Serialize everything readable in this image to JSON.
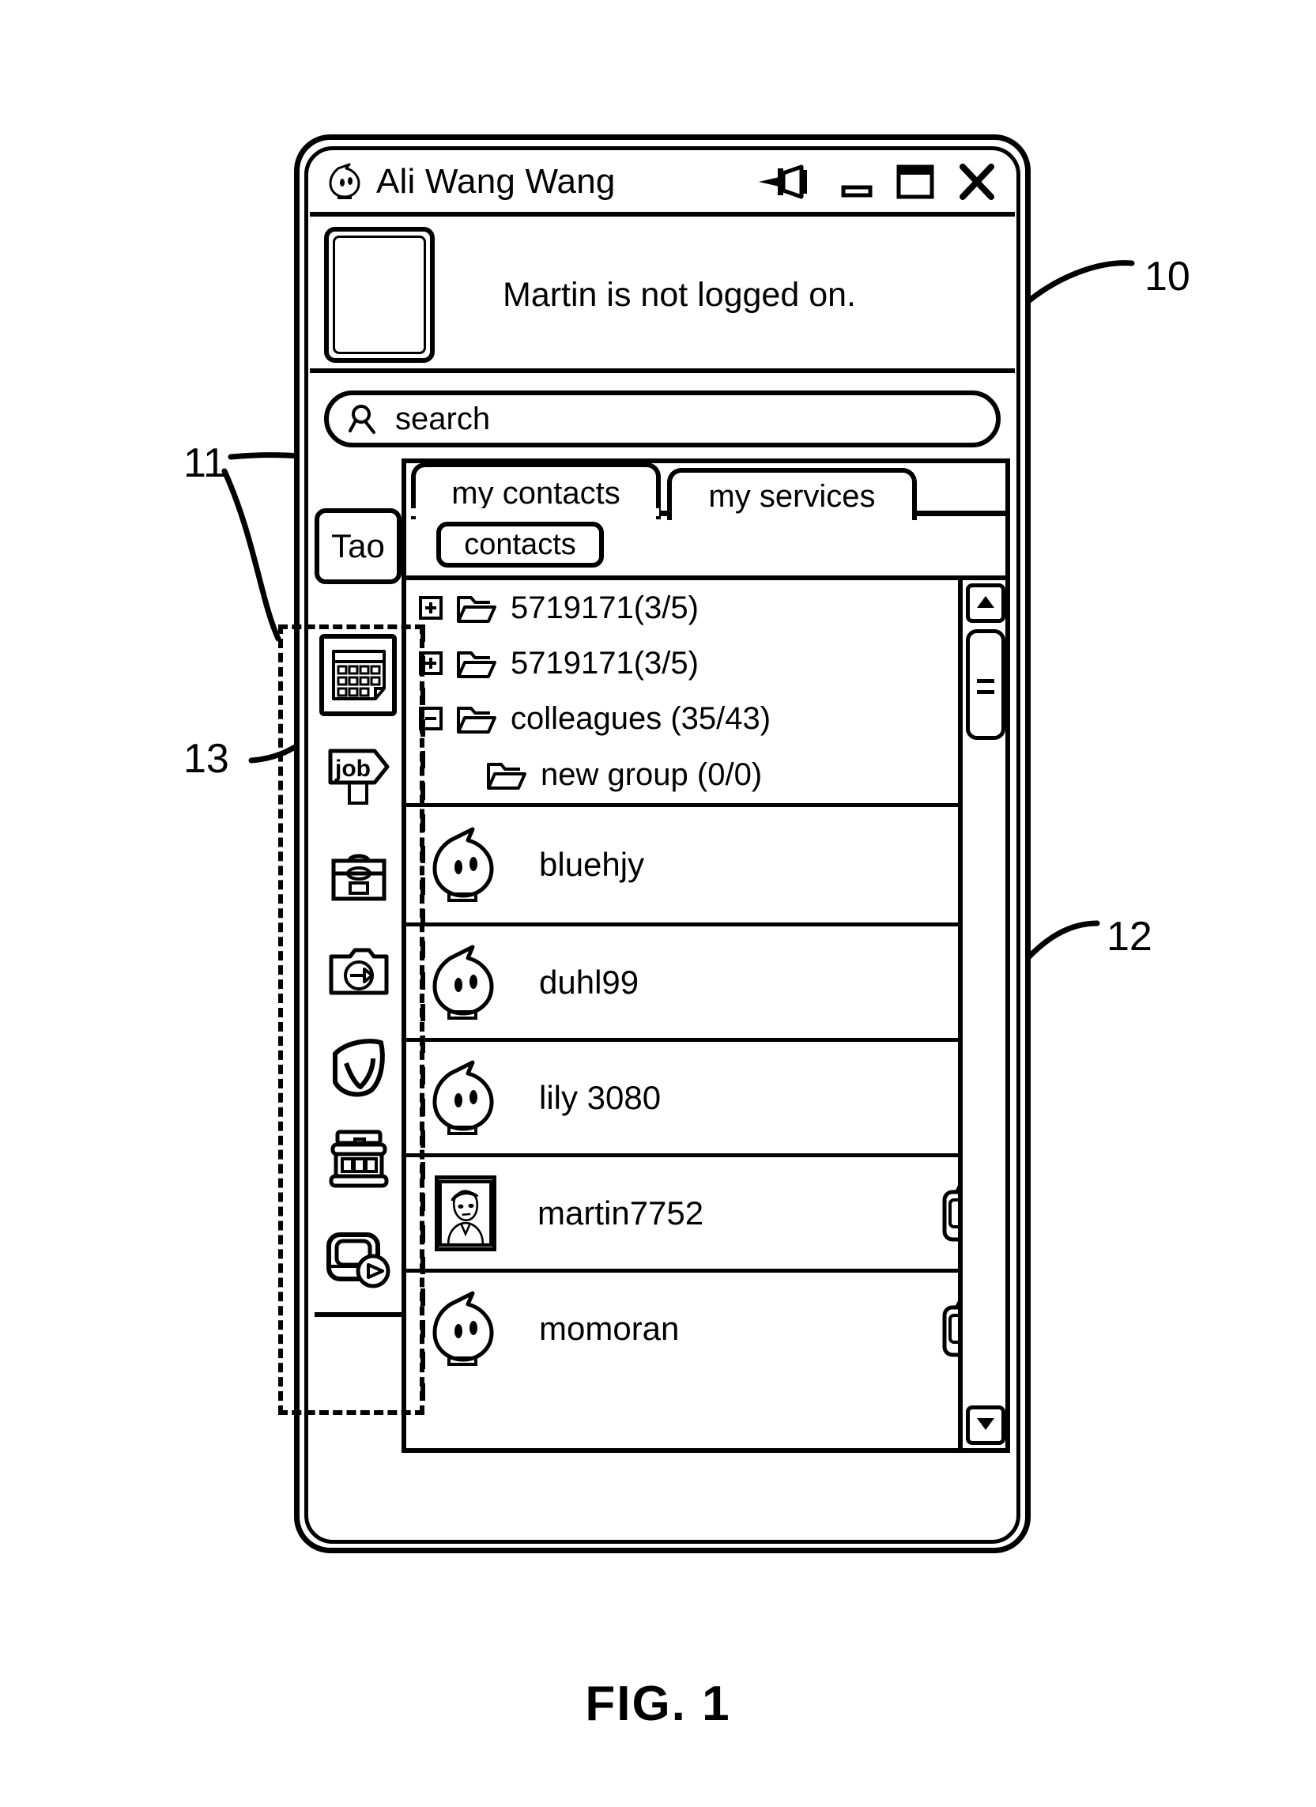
{
  "figure": {
    "caption": "FIG. 1",
    "reference_numerals": [
      {
        "id": "10",
        "label": "10"
      },
      {
        "id": "11",
        "label": "11"
      },
      {
        "id": "12",
        "label": "12"
      },
      {
        "id": "13",
        "label": "13"
      }
    ]
  },
  "window": {
    "title": "Ali Wang Wang",
    "logo_icon": "wangwang-avatar-icon",
    "controls": [
      {
        "name": "pin-button",
        "icon": "pushpin-icon"
      },
      {
        "name": "minimize-button",
        "icon": "minimize-icon"
      },
      {
        "name": "maximize-button",
        "icon": "maximize-icon"
      },
      {
        "name": "close-button",
        "icon": "close-icon"
      }
    ]
  },
  "profile": {
    "avatar_icon": "user-avatar-placeholder",
    "status_text": "Martin is not logged on."
  },
  "search": {
    "icon": "search-icon",
    "placeholder": "search",
    "value": "search"
  },
  "tabs": [
    {
      "id": "my-contacts",
      "label": "my contacts",
      "active": true
    },
    {
      "id": "my-services",
      "label": "my services",
      "active": false
    }
  ],
  "tao_button": {
    "label": "Tao"
  },
  "subtoolbar": {
    "contacts_chip_label": "contacts"
  },
  "sidebar": {
    "items": [
      {
        "id": "calendar",
        "icon": "calendar-grid-icon",
        "selected": true
      },
      {
        "id": "job",
        "icon": "job-signpost-icon",
        "selected": false
      },
      {
        "id": "briefcase",
        "icon": "briefcase-icon",
        "selected": false
      },
      {
        "id": "folder-transfer",
        "icon": "folder-arrow-icon",
        "selected": false
      },
      {
        "id": "shield",
        "icon": "shield-check-icon",
        "selected": false
      },
      {
        "id": "shop",
        "icon": "storefront-icon",
        "selected": false
      },
      {
        "id": "media",
        "icon": "media-player-play-icon",
        "selected": false
      }
    ]
  },
  "contact_list": {
    "groups": [
      {
        "id": "g1",
        "expander": "plus",
        "icon": "folder-icon",
        "label": "5719171(3/5)"
      },
      {
        "id": "g2",
        "expander": "plus",
        "icon": "folder-icon",
        "label": "5719171(3/5)"
      },
      {
        "id": "g3",
        "expander": "minus",
        "icon": "folder-icon",
        "label": "colleagues (35/43)"
      },
      {
        "id": "g4",
        "expander": "none",
        "icon": "folder-icon",
        "label": "new group (0/0)"
      }
    ],
    "contacts": [
      {
        "id": "c1",
        "name": "bluehjy",
        "avatar": "wangwang-avatar-icon",
        "mobile": false
      },
      {
        "id": "c2",
        "name": "duhl99",
        "avatar": "wangwang-avatar-icon",
        "mobile": false
      },
      {
        "id": "c3",
        "name": "lily 3080",
        "avatar": "wangwang-avatar-icon",
        "mobile": false
      },
      {
        "id": "c4",
        "name": "martin7752",
        "avatar": "photo-portrait-icon",
        "mobile": true
      },
      {
        "id": "c5",
        "name": "momoran",
        "avatar": "wangwang-avatar-icon",
        "mobile": true
      }
    ]
  },
  "scrollbar": {
    "up_icon": "triangle-up-icon",
    "down_icon": "triangle-down-icon",
    "thumb": "scroll-thumb"
  }
}
